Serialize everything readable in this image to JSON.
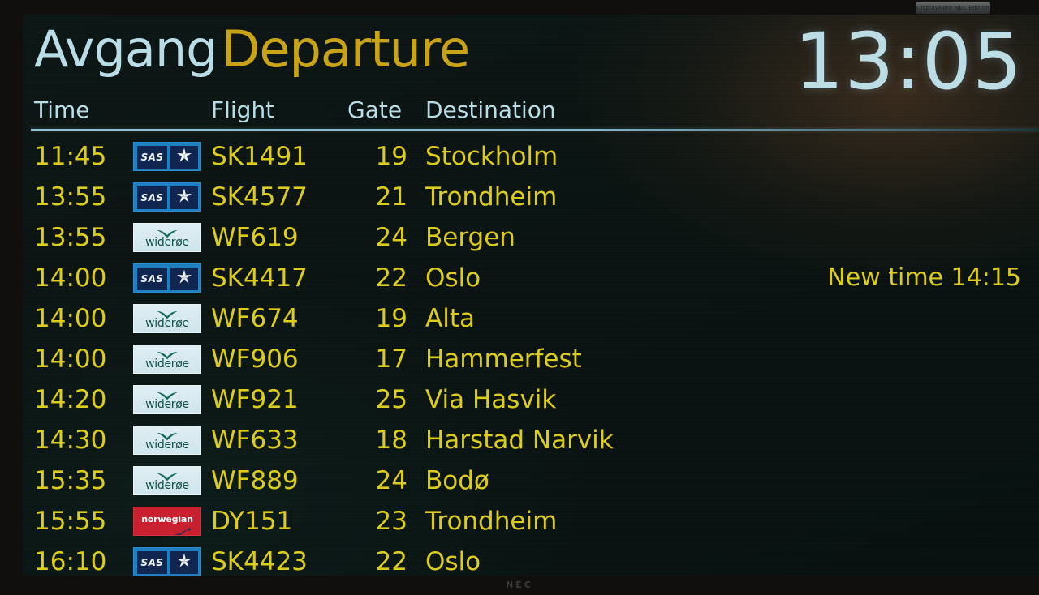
{
  "device": {
    "brand_label": "NEC",
    "bezel_sticker": "DisplayNote NEC Edition"
  },
  "board": {
    "title_native": "Avgang",
    "title_english": "Departure",
    "clock": "13:05",
    "colors": {
      "screen_background": "#0a1311",
      "header_native": "#b9dde6",
      "header_english": "#c9a316",
      "clock": "#bcdde5",
      "column_header": "#b9dde6",
      "row_text": "#dccc1c",
      "divider": "#8fc4d2",
      "sas_plate": "#1e7fc2",
      "sas_tile": "#10254f",
      "wideroe_plate": "#dfeef3",
      "wideroe_text": "#12514a",
      "norwegian_plate": "#c8202f"
    },
    "columns": {
      "time": "Time",
      "flight": "Flight",
      "gate": "Gate",
      "destination": "Destination"
    },
    "notice": {
      "text": "New time 14:15",
      "row_index": 3
    },
    "rows": [
      {
        "time": "11:45",
        "airline": "sas",
        "airline_name": "SAS",
        "flight": "SK1491",
        "gate": "19",
        "destination": "Stockholm"
      },
      {
        "time": "13:55",
        "airline": "sas",
        "airline_name": "SAS",
        "flight": "SK4577",
        "gate": "21",
        "destination": "Trondheim"
      },
      {
        "time": "13:55",
        "airline": "wideroe",
        "airline_name": "widerøe",
        "flight": "WF619",
        "gate": "24",
        "destination": "Bergen"
      },
      {
        "time": "14:00",
        "airline": "sas",
        "airline_name": "SAS",
        "flight": "SK4417",
        "gate": "22",
        "destination": "Oslo"
      },
      {
        "time": "14:00",
        "airline": "wideroe",
        "airline_name": "widerøe",
        "flight": "WF674",
        "gate": "19",
        "destination": "Alta"
      },
      {
        "time": "14:00",
        "airline": "wideroe",
        "airline_name": "widerøe",
        "flight": "WF906",
        "gate": "17",
        "destination": "Hammerfest"
      },
      {
        "time": "14:20",
        "airline": "wideroe",
        "airline_name": "widerøe",
        "flight": "WF921",
        "gate": "25",
        "destination": "Via Hasvik"
      },
      {
        "time": "14:30",
        "airline": "wideroe",
        "airline_name": "widerøe",
        "flight": "WF633",
        "gate": "18",
        "destination": "Harstad Narvik"
      },
      {
        "time": "15:35",
        "airline": "wideroe",
        "airline_name": "widerøe",
        "flight": "WF889",
        "gate": "24",
        "destination": "Bodø"
      },
      {
        "time": "15:55",
        "airline": "norwegian",
        "airline_name": "norwegian",
        "flight": "DY151",
        "gate": "23",
        "destination": "Trondheim"
      },
      {
        "time": "16:10",
        "airline": "sas",
        "airline_name": "SAS",
        "flight": "SK4423",
        "gate": "22",
        "destination": "Oslo"
      }
    ]
  }
}
